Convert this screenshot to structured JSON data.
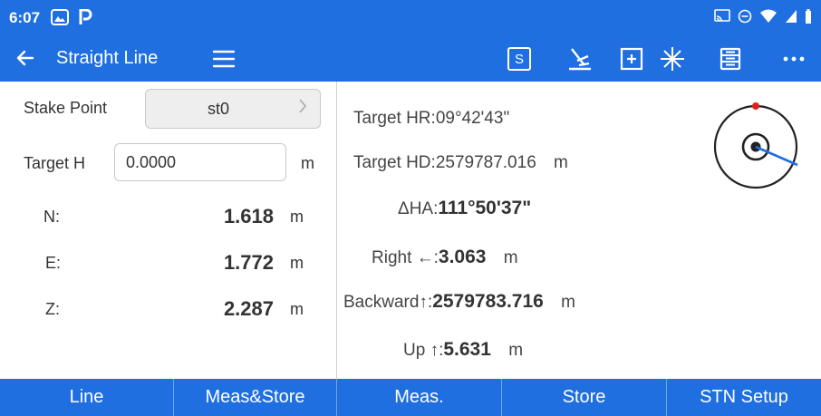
{
  "status_bar": {
    "time": "6:07",
    "left_icons": [
      "gallery-icon",
      "parking-app-icon"
    ],
    "right_icons": [
      "cast-icon",
      "do-not-disturb-icon",
      "wifi-icon",
      "signal-icon",
      "battery-icon"
    ]
  },
  "app_bar": {
    "title": "Straight Line",
    "s_label": "S",
    "tools": [
      "s-icon",
      "stake-person-icon",
      "target-box-icon",
      "crosshair-icon",
      "list-icon",
      "more-icon"
    ]
  },
  "left": {
    "stake_point_label": "Stake Point",
    "stake_point_value": "st0",
    "target_h_label": "Target H",
    "target_h_value": "0.0000",
    "unit": "m",
    "n_label": "N:",
    "n_value": "1.618",
    "e_label": "E:",
    "e_value": "1.772",
    "z_label": "Z:",
    "z_value": "2.287"
  },
  "right": {
    "target_hr_label": "Target HR:",
    "target_hr_value": "09°42'43\"",
    "target_hd_label": "Target HD:",
    "target_hd_value": "2579787.016",
    "dha_label": "ΔHA:",
    "dha_value": "111°50'37\"",
    "right_label": "Right ←:",
    "right_value": "3.063",
    "backward_label": "Backward↑:",
    "backward_value": "2579783.716",
    "up_label": "Up ↑:",
    "up_value": "5.631",
    "unit": "m"
  },
  "bottom": {
    "buttons": [
      "Line",
      "Meas&Store",
      "Meas.",
      "Store",
      "STN Setup"
    ]
  },
  "colors": {
    "primary": "#1f6fe0",
    "compass_red": "#e02020",
    "compass_blue": "#1f6fe0"
  }
}
